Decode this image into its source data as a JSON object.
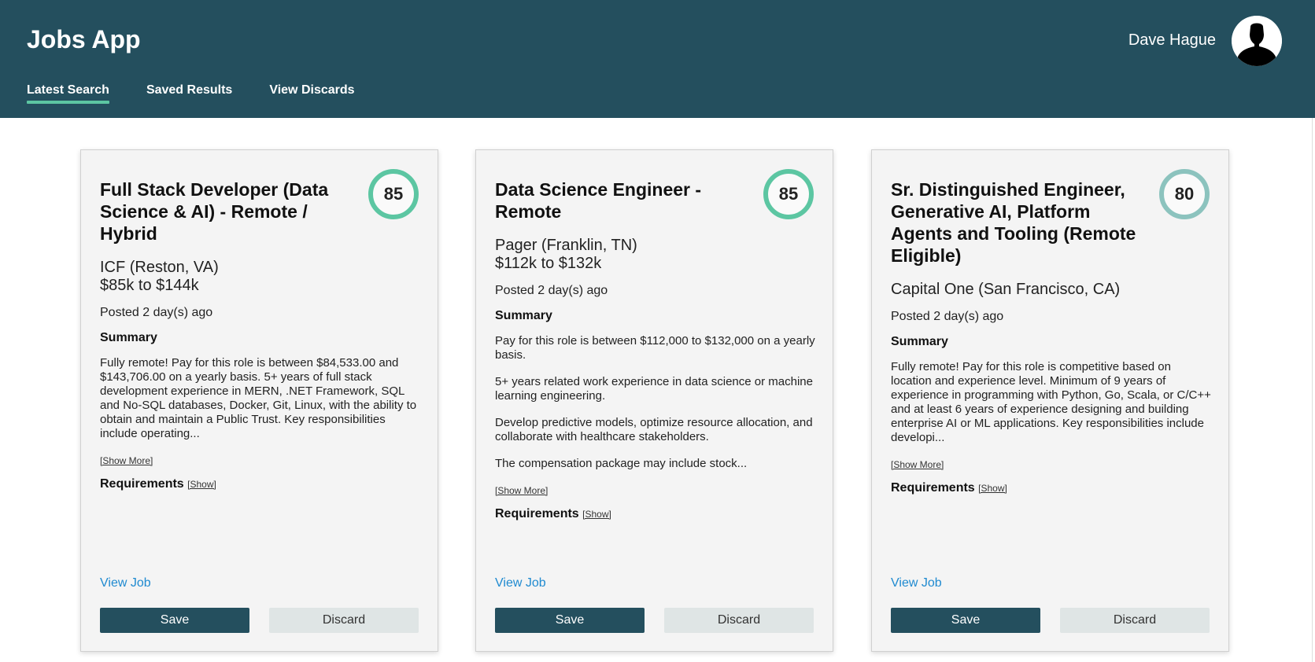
{
  "app": {
    "title": "Jobs App",
    "user_name": "Dave Hague"
  },
  "nav": [
    {
      "label": "Latest Search",
      "active": true
    },
    {
      "label": "Saved Results",
      "active": false
    },
    {
      "label": "View Discards",
      "active": false
    }
  ],
  "colors": {
    "header": "#244f5e",
    "accent": "#5cc6a2",
    "muted_score": "#8cc3be",
    "link": "#1f8ad0"
  },
  "cards": [
    {
      "title": "Full Stack Developer (Data Science & AI) - Remote / Hybrid",
      "score": "85",
      "company": "ICF (Reston, VA)",
      "salary": "$85k to $144k",
      "posted": "Posted 2 day(s) ago",
      "summary_heading": "Summary",
      "summary": [
        "Fully remote! Pay for this role is between $84,533.00 and $143,706.00 on a yearly basis. 5+ years of full stack development experience in MERN, .NET Framework, SQL and No-SQL databases, Docker, Git, Linux, with the ability to obtain and maintain a Public Trust. Key responsibilities include operating..."
      ],
      "show_more": "[Show More]",
      "requirements": "Requirements",
      "req_show": "[Show]",
      "view_job": "View Job",
      "save": "Save",
      "discard": "Discard"
    },
    {
      "title": "Data Science Engineer - Remote",
      "score": "85",
      "company": "Pager (Franklin, TN)",
      "salary": "$112k to $132k",
      "posted": "Posted 2 day(s) ago",
      "summary_heading": "Summary",
      "summary": [
        "Pay for this role is between $112,000 to $132,000 on a yearly basis.",
        "5+ years related work experience in data science or machine learning engineering.",
        "Develop predictive models, optimize resource allocation, and collaborate with healthcare stakeholders.",
        "The compensation package may include stock..."
      ],
      "show_more": "[Show More]",
      "requirements": "Requirements",
      "req_show": "[Show]",
      "view_job": "View Job",
      "save": "Save",
      "discard": "Discard"
    },
    {
      "title": "Sr. Distinguished Engineer, Generative AI, Platform Agents and Tooling (Remote Eligible)",
      "score": "80",
      "company": "Capital One (San Francisco, CA)",
      "salary": "",
      "posted": "Posted 2 day(s) ago",
      "summary_heading": "Summary",
      "summary": [
        "Fully remote! Pay for this role is competitive based on location and experience level. Minimum of 9 years of experience in programming with Python, Go, Scala, or C/C++ and at least 6 years of experience designing and building enterprise AI or ML applications. Key responsibilities include developi..."
      ],
      "show_more": "[Show More]",
      "requirements": "Requirements",
      "req_show": "[Show]",
      "view_job": "View Job",
      "save": "Save",
      "discard": "Discard"
    }
  ]
}
